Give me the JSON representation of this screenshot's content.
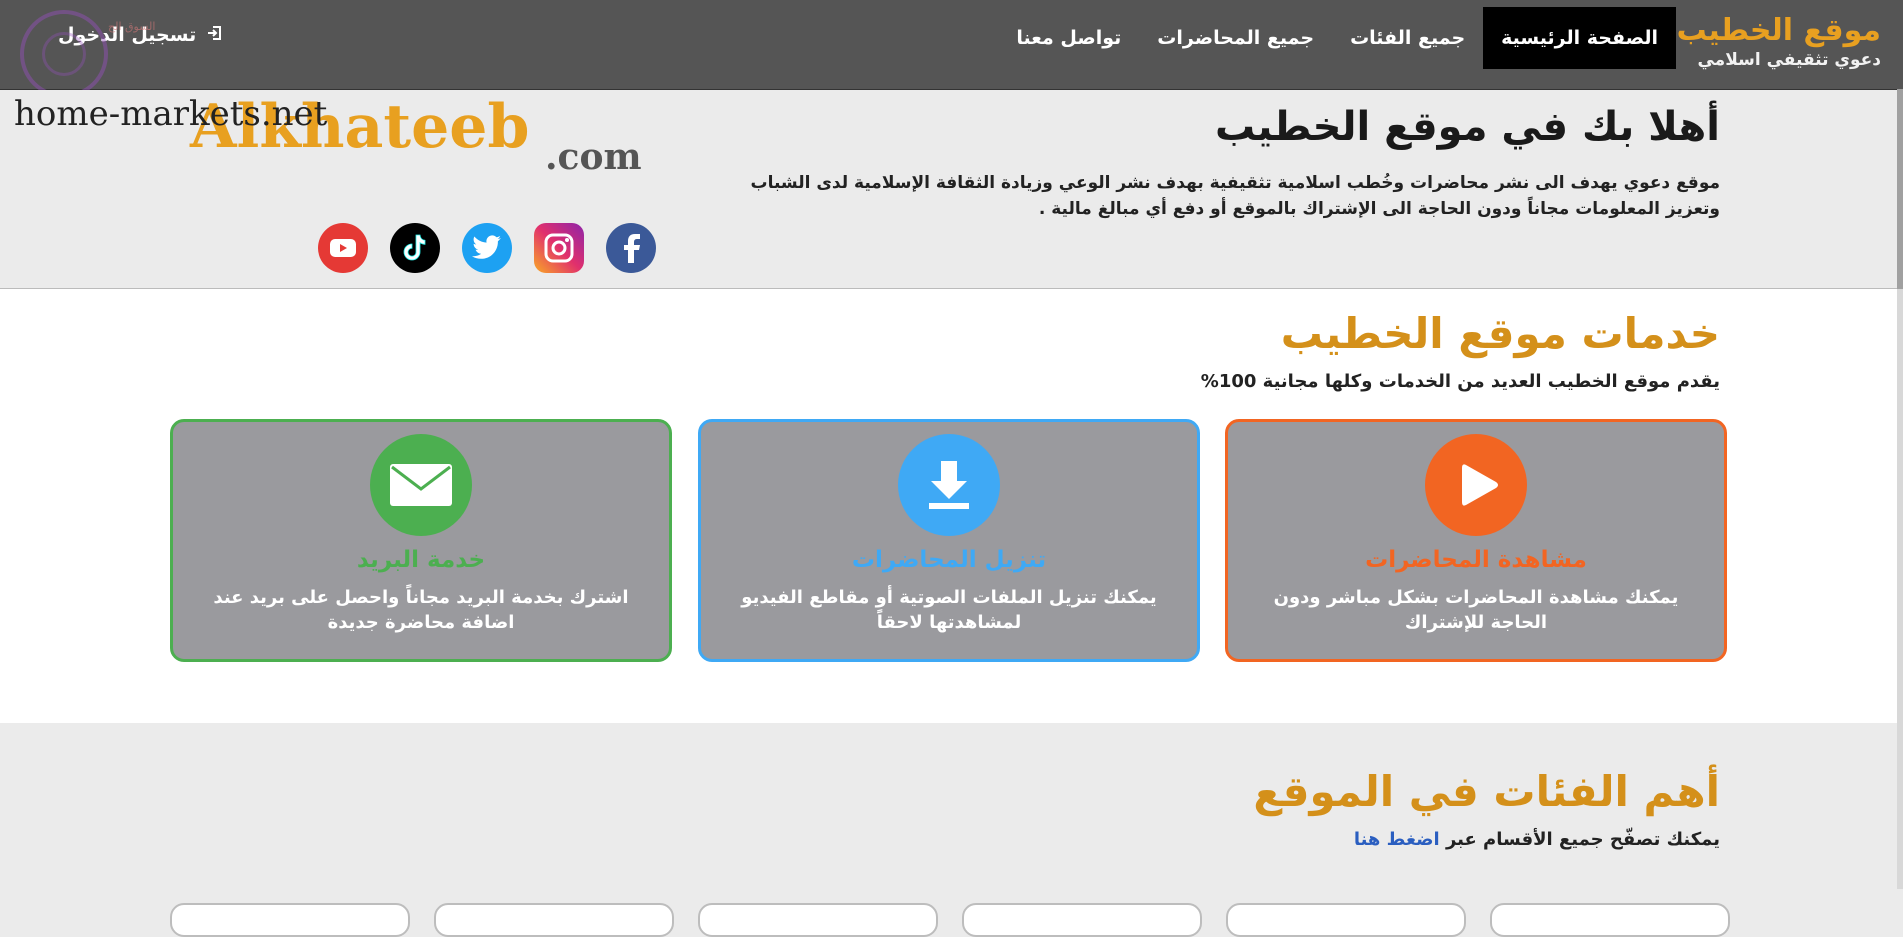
{
  "header": {
    "brand_title": "موقع الخطيب",
    "brand_subtitle": "دعوي تثقيفي اسلامي",
    "nav": [
      {
        "label": "الصفحة الرئيسية",
        "active": true
      },
      {
        "label": "جميع الفئات",
        "active": false
      },
      {
        "label": "جميع المحاضرات",
        "active": false
      },
      {
        "label": "تواصل معنا",
        "active": false
      }
    ],
    "login_label": "تسجيل الدخول",
    "login_icon": "sign-in-icon"
  },
  "watermark": {
    "text": "home-markets.net",
    "small_text": "السوق الح"
  },
  "hero": {
    "title": "أهلا بك في موقع الخطيب",
    "description": "موقع دعوي يهدف الى نشر محاضرات وخُطب اسلامية تثقيفية بهدف نشر الوعي وزيادة الثقافة الإسلامية لدى الشباب وتعزيز المعلومات مجاناً ودون الحاجة الى الإشتراك بالموقع أو دفع أي مبالغ مالية .",
    "logo_text": "Alkhateeb",
    "logo_suffix": ".com",
    "socials": [
      {
        "name": "facebook-icon",
        "color": "#3b5998"
      },
      {
        "name": "instagram-icon",
        "color": "#e1306c"
      },
      {
        "name": "twitter-icon",
        "color": "#1da1f2"
      },
      {
        "name": "tiktok-icon",
        "color": "#000000"
      },
      {
        "name": "youtube-icon",
        "color": "#e53935"
      }
    ]
  },
  "services": {
    "title": "خدمات موقع الخطيب",
    "subtitle": "يقدم موقع الخطيب العديد من الخدمات وكلها مجانية 100%",
    "cards": [
      {
        "title": "مشاهدة المحاضرات",
        "text": "يمكنك مشاهدة المحاضرات بشكل مباشر ودون الحاجة للإشتراك",
        "color": "#f26522",
        "icon": "play-icon"
      },
      {
        "title": "تنزيل المحاضرات",
        "text": "يمكنك تنزيل الملفات الصوتية أو مقاطع الفيديو لمشاهدتها لاحقاً",
        "color": "#3fa9f5",
        "icon": "download-icon"
      },
      {
        "title": "خدمة البريد",
        "text": "اشترك بخدمة البريد مجاناً واحصل على بريد عند اضافة محاضرة جديدة",
        "color": "#4caf50",
        "icon": "mail-icon"
      }
    ]
  },
  "categories": {
    "title": "أهم الفئات في الموقع",
    "subtitle_text": "يمكنك تصفّح جميع الأقسام عبر",
    "subtitle_link": "اضغط هنا"
  }
}
